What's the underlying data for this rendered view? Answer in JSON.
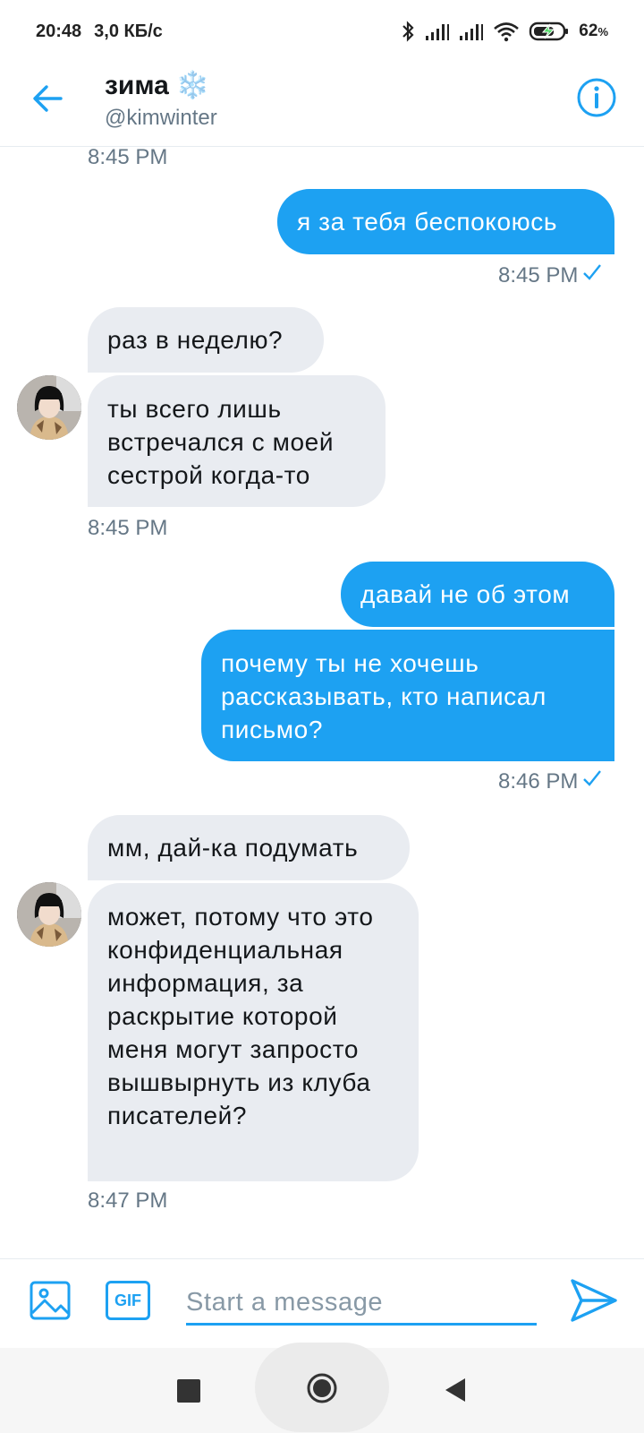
{
  "status_bar": {
    "time": "20:48",
    "net_speed": "3,0 КБ/с",
    "battery": "62",
    "battery_unit": "%"
  },
  "header": {
    "name": "зима",
    "name_emoji": "❄️",
    "handle": "@kimwinter"
  },
  "conversation": {
    "top_timestamp": "8:45 PM",
    "messages": [
      {
        "direction": "out",
        "text": "я за тебя беспокоюсь"
      },
      {
        "direction": "out_ts",
        "text": "8:45 PM"
      },
      {
        "direction": "in",
        "text": "раз в неделю?"
      },
      {
        "direction": "in",
        "text": "ты всего лишь встречался с моей сестрой когда-то"
      },
      {
        "direction": "in_ts",
        "text": "8:45 PM"
      },
      {
        "direction": "out",
        "text": "давай не об этом"
      },
      {
        "direction": "out",
        "text": "почему ты не хочешь рассказывать, кто написал письмо?"
      },
      {
        "direction": "out_ts",
        "text": "8:46 PM"
      },
      {
        "direction": "in",
        "text": "мм, дай-ка подумать"
      },
      {
        "direction": "in",
        "text": "может, потому что это конфиденциальная информация, за раскрытие которой меня могут запросто вышвырнуть из клуба писателей?"
      },
      {
        "direction": "in_ts",
        "text": "8:47 PM"
      }
    ]
  },
  "composer": {
    "placeholder": "Start a message",
    "gif_label": "GIF"
  },
  "colors": {
    "accent": "#1da1f2",
    "incoming_bubble": "#e9ecf1",
    "muted_text": "#657786"
  },
  "icons": {
    "back": "arrow-left-icon",
    "info": "info-icon",
    "image": "image-icon",
    "send": "send-icon",
    "read_receipt": "check-icon"
  }
}
